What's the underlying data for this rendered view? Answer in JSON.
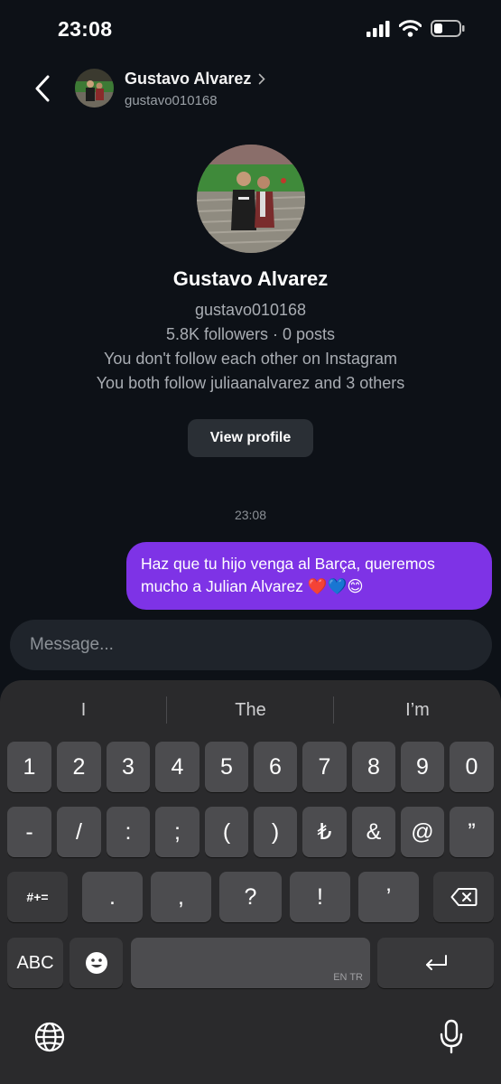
{
  "status_bar": {
    "time": "23:08"
  },
  "header": {
    "name": "Gustavo Alvarez",
    "username": "gustavo010168"
  },
  "profile": {
    "name": "Gustavo Alvarez",
    "username": "gustavo010168",
    "stats": "5.8K followers · 0 posts",
    "follow_status": "You don't follow each other on Instagram",
    "mutuals": "You both follow juliaanalvarez and 3 others",
    "view_profile_label": "View profile"
  },
  "chat": {
    "timestamp": "23:08",
    "message": "Haz que tu hijo venga al Barça, queremos mucho a Julian  Alvarez ❤️💙😊"
  },
  "composer": {
    "placeholder": "Message..."
  },
  "keyboard": {
    "suggestions": [
      "I",
      "The",
      "I’m"
    ],
    "row1": [
      "1",
      "2",
      "3",
      "4",
      "5",
      "6",
      "7",
      "8",
      "9",
      "0"
    ],
    "row2": [
      "-",
      "/",
      ":",
      ";",
      "(",
      ")",
      "₺",
      "&",
      "@",
      "”"
    ],
    "row3_mode": "#+=",
    "row3": [
      ".",
      ",",
      "?",
      "!",
      "’"
    ],
    "abc_label": "ABC",
    "space_lang": "EN TR"
  },
  "colors": {
    "accent": "#7e33e6",
    "background": "#0d1117",
    "keyboard": "#2a2a2c"
  }
}
